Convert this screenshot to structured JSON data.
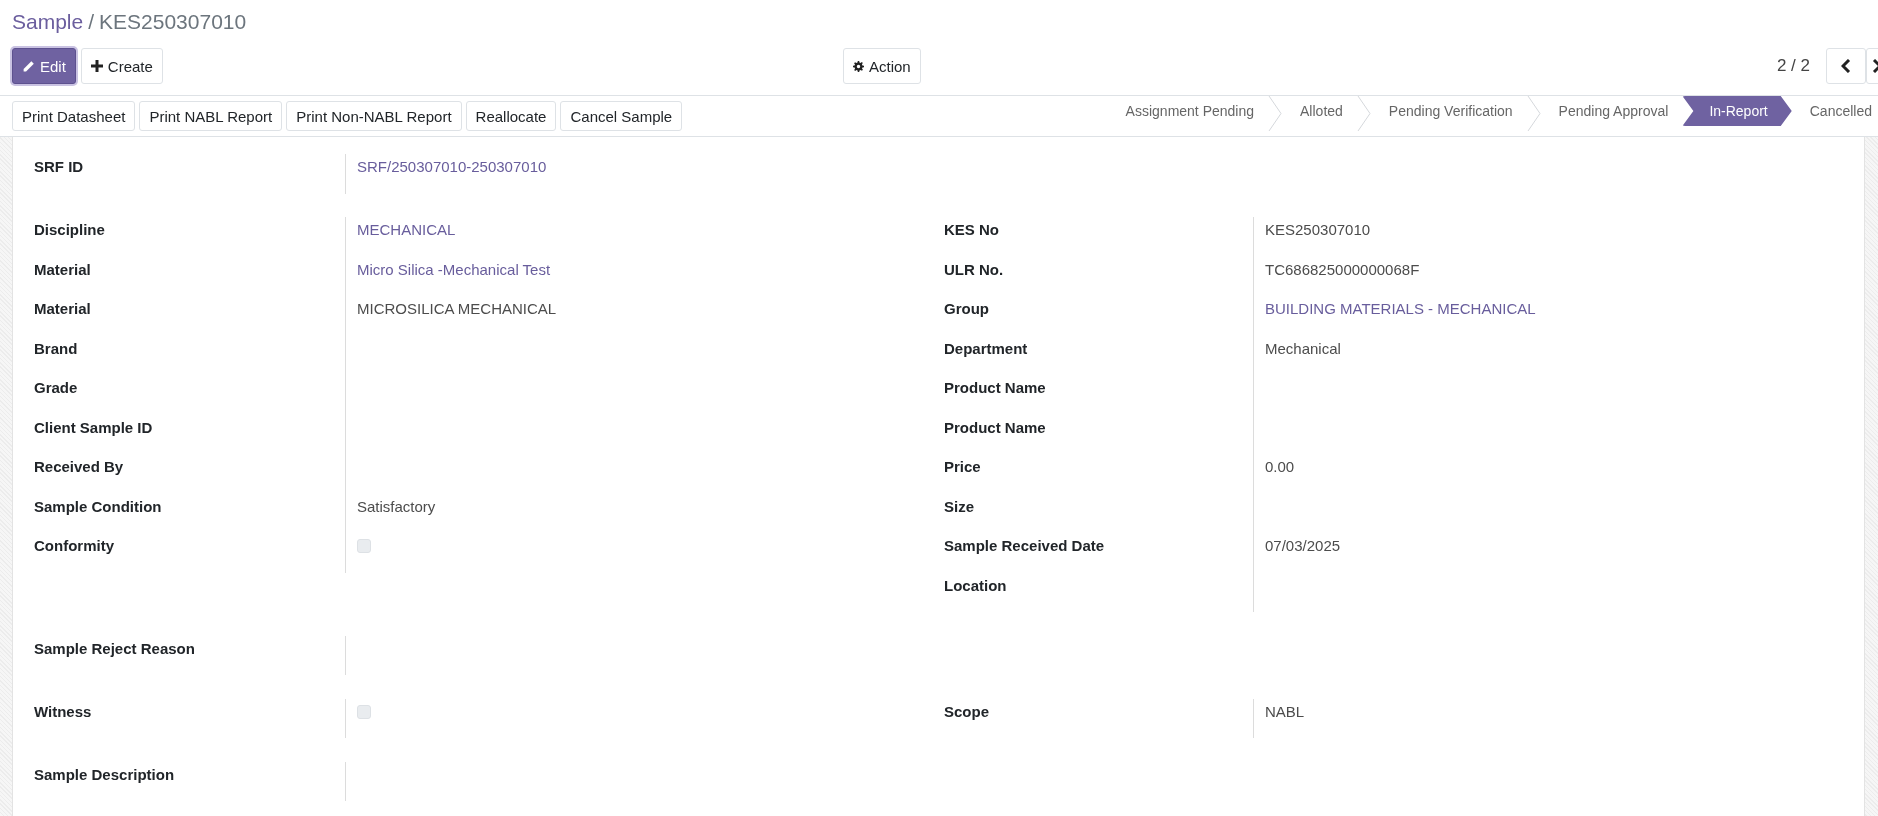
{
  "breadcrumb": {
    "parent": "Sample",
    "separator": "/",
    "current": "KES250307010"
  },
  "control_panel": {
    "edit_button": "Edit",
    "create_button": "Create",
    "action_button": "Action",
    "pager": "2 / 2"
  },
  "header_buttons": [
    "Print Datasheet",
    "Print NABL Report",
    "Print Non-NABL Report",
    "Reallocate",
    "Cancel Sample"
  ],
  "statusbar": [
    {
      "label": "Assignment Pending",
      "selected": false
    },
    {
      "label": "Alloted",
      "selected": false
    },
    {
      "label": "Pending Verification",
      "selected": false
    },
    {
      "label": "Pending Approval",
      "selected": false
    },
    {
      "label": "In-Report",
      "selected": true
    },
    {
      "label": "Cancelled",
      "selected": false
    }
  ],
  "groups": [
    {
      "left": [
        {
          "label": "SRF ID",
          "kind": "link",
          "value": "SRF/250307010-250307010"
        }
      ]
    },
    {
      "left": [
        {
          "label": "Discipline",
          "kind": "link",
          "value": "MECHANICAL"
        },
        {
          "label": "Material",
          "kind": "link",
          "value": "Micro Silica -Mechanical Test"
        },
        {
          "label": "Material",
          "kind": "text",
          "value": "MICROSILICA MECHANICAL"
        },
        {
          "label": "Brand",
          "kind": "text"
        },
        {
          "label": "Grade",
          "kind": "text"
        },
        {
          "label": "Client Sample ID",
          "kind": "text"
        },
        {
          "label": "Received By",
          "kind": "text"
        },
        {
          "label": "Sample Condition",
          "kind": "text",
          "value": "Satisfactory"
        },
        {
          "label": "Conformity",
          "kind": "checkbox",
          "checked": false
        }
      ],
      "right": [
        {
          "label": "KES No",
          "kind": "text",
          "value": "KES250307010"
        },
        {
          "label": "ULR No.",
          "kind": "text",
          "value": "TC686825000000068F"
        },
        {
          "label": "Group",
          "kind": "link",
          "value": "BUILDING MATERIALS - MECHANICAL"
        },
        {
          "label": "Department",
          "kind": "text",
          "value": "Mechanical"
        },
        {
          "label": "Product Name",
          "kind": "text"
        },
        {
          "label": "Product Name",
          "kind": "text"
        },
        {
          "label": "Price",
          "kind": "text",
          "value": "0.00"
        },
        {
          "label": "Size",
          "kind": "text"
        },
        {
          "label": "Sample Received Date",
          "kind": "text",
          "value": "07/03/2025"
        },
        {
          "label": "Location",
          "kind": "text"
        }
      ]
    },
    {
      "left": [
        {
          "label": "Sample Reject Reason",
          "kind": "text"
        }
      ]
    },
    {
      "left": [
        {
          "label": "Witness",
          "kind": "checkbox",
          "checked": false
        }
      ],
      "right": [
        {
          "label": "Scope",
          "kind": "text",
          "value": "NABL"
        }
      ]
    },
    {
      "left": [
        {
          "label": "Sample Description",
          "kind": "text"
        }
      ]
    }
  ]
}
